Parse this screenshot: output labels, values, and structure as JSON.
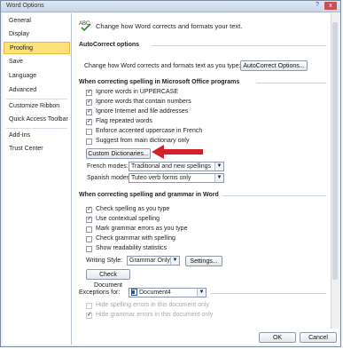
{
  "window": {
    "title": "Word Options",
    "help": "?",
    "close": "x"
  },
  "sidebar": {
    "items": [
      {
        "label": "General"
      },
      {
        "label": "Display"
      },
      {
        "label": "Proofing"
      },
      {
        "label": "Save"
      },
      {
        "label": "Language"
      },
      {
        "label": "Advanced"
      },
      {
        "label": "Customize Ribbon"
      },
      {
        "label": "Quick Access Toolbar"
      },
      {
        "label": "Add-Ins"
      },
      {
        "label": "Trust Center"
      }
    ]
  },
  "header": {
    "text": "Change how Word corrects and formats your text."
  },
  "autocorrect": {
    "heading": "AutoCorrect options",
    "desc": "Change how Word corrects and formats text as you type:",
    "button": "AutoCorrect Options..."
  },
  "office_spelling": {
    "heading": "When correcting spelling in Microsoft Office programs",
    "options": [
      {
        "label": "Ignore words in UPPERCASE",
        "checked": true
      },
      {
        "label": "Ignore words that contain numbers",
        "checked": true
      },
      {
        "label": "Ignore Internet and file addresses",
        "checked": true
      },
      {
        "label": "Flag repeated words",
        "checked": true
      },
      {
        "label": "Enforce accented uppercase in French",
        "checked": false
      },
      {
        "label": "Suggest from main dictionary only",
        "checked": false
      }
    ],
    "custom_dict_button": "Custom Dictionaries...",
    "french_label": "French modes:",
    "french_value": "Traditional and new spellings",
    "spanish_label": "Spanish modes:",
    "spanish_value": "Tuteo verb forms only"
  },
  "word_spelling": {
    "heading": "When correcting spelling and grammar in Word",
    "options": [
      {
        "label": "Check spelling as you type",
        "checked": true
      },
      {
        "label": "Use contextual spelling",
        "checked": true
      },
      {
        "label": "Mark grammar errors as you type",
        "checked": false
      },
      {
        "label": "Check grammar with spelling",
        "checked": false
      },
      {
        "label": "Show readability statistics",
        "checked": false
      }
    ],
    "writing_style_label": "Writing Style:",
    "writing_style_value": "Grammar Only",
    "settings_button": "Settings...",
    "check_document_button": "Check Document"
  },
  "exceptions": {
    "label": "Exceptions for:",
    "document": "Document4",
    "options": [
      {
        "label": "Hide spelling errors in this document only",
        "checked": false
      },
      {
        "label": "Hide grammar errors in this document only",
        "checked": true
      }
    ]
  },
  "footer": {
    "ok": "OK",
    "cancel": "Cancel"
  },
  "colors": {
    "accent_red": "#d2212a",
    "active_nav": "#ffe17a"
  }
}
